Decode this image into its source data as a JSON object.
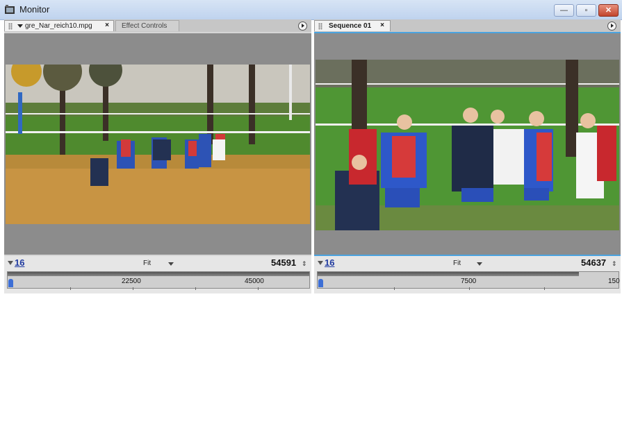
{
  "window": {
    "title": "Monitor"
  },
  "source_panel": {
    "tabs": [
      {
        "label": "gre_Nar_reich10.mpg"
      },
      {
        "label": "Effect Controls"
      }
    ],
    "in_point": "16",
    "zoom": "Fit",
    "duration": "54591",
    "ruler_labels": [
      "22500",
      "45000"
    ]
  },
  "program_panel": {
    "tabs": [
      {
        "label": "Sequence 01"
      }
    ],
    "in_point": "16",
    "zoom": "Fit",
    "duration": "54637",
    "ruler_labels": [
      "7500",
      "150"
    ]
  },
  "colors": {
    "accent": "#4aa3df",
    "timecode_blue": "#1f3aa0",
    "panel_bg": "#d6d6d6",
    "video_bg": "#8c8c8c"
  }
}
